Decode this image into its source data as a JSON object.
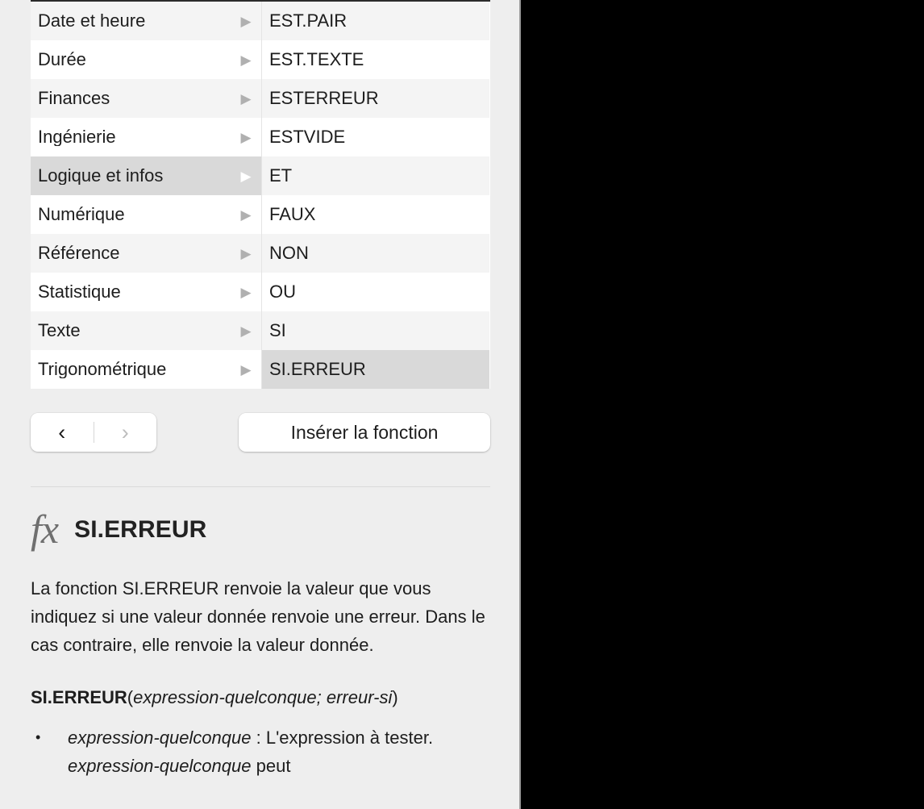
{
  "panel": {
    "accent_selected_bg": "#d9d9d9",
    "panel_bg": "#eeeeee"
  },
  "browser": {
    "categories_header": "",
    "categories": [
      {
        "label": "Date et heure",
        "disclosure": "triangle-right-icon",
        "selected": false
      },
      {
        "label": "Durée",
        "disclosure": "triangle-right-icon",
        "selected": false
      },
      {
        "label": "Finances",
        "disclosure": "triangle-right-icon",
        "selected": false
      },
      {
        "label": "Ingénierie",
        "disclosure": "triangle-right-icon",
        "selected": false
      },
      {
        "label": "Logique et infos",
        "disclosure": "triangle-right-icon",
        "selected": true
      },
      {
        "label": "Numérique",
        "disclosure": "triangle-right-icon",
        "selected": false
      },
      {
        "label": "Référence",
        "disclosure": "triangle-right-icon",
        "selected": false
      },
      {
        "label": "Statistique",
        "disclosure": "triangle-right-icon",
        "selected": false
      },
      {
        "label": "Texte",
        "disclosure": "triangle-right-icon",
        "selected": false
      },
      {
        "label": "Trigonométrique",
        "disclosure": "triangle-right-icon",
        "selected": false
      }
    ],
    "functions": [
      {
        "label": "EST.PAIR",
        "selected": false
      },
      {
        "label": "EST.TEXTE",
        "selected": false
      },
      {
        "label": "ESTERREUR",
        "selected": false
      },
      {
        "label": "ESTVIDE",
        "selected": false
      },
      {
        "label": "ET",
        "selected": false
      },
      {
        "label": "FAUX",
        "selected": false
      },
      {
        "label": "NON",
        "selected": false
      },
      {
        "label": "OU",
        "selected": false
      },
      {
        "label": "SI",
        "selected": false
      },
      {
        "label": "SI.ERREUR",
        "selected": true
      }
    ]
  },
  "toolbar": {
    "back_icon": "chevron-left-icon",
    "back_glyph": "‹",
    "forward_icon": "chevron-right-icon",
    "forward_glyph": "›",
    "insert_label": "Insérer la fonction"
  },
  "detail": {
    "fx_icon": "fx-icon",
    "fx_glyph": "fx",
    "title": "SI.ERREUR",
    "description": "La fonction SI.ERREUR renvoie la valeur que vous indiquez si une valeur donnée renvoie une erreur. Dans le cas contraire, elle renvoie la valeur donnée.",
    "syntax": {
      "function_name": "SI.ERREUR",
      "open_paren": "(",
      "arg1": "expression-quelconque",
      "separator": "; ",
      "arg2": "erreur-si",
      "close_paren": ")"
    },
    "arguments": [
      {
        "bullet": "•",
        "name": "expression-quelconque",
        "separator": " : ",
        "text_before": "L'expression à tester. ",
        "name_repeat": "expression-quelconque",
        "text_after": " peut"
      }
    ]
  }
}
